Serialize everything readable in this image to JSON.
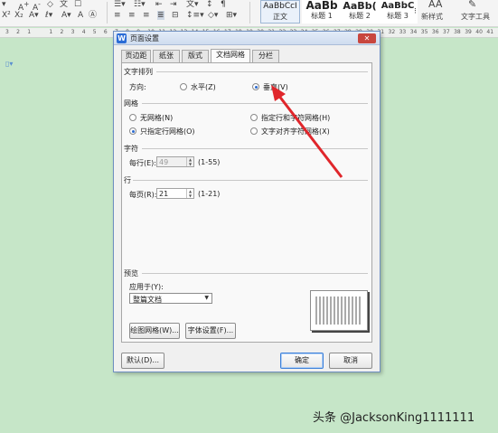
{
  "ribbon": {
    "styles": [
      {
        "sample": "AaBbCcI",
        "label": "正文"
      },
      {
        "sample": "AaBb",
        "label": "标题 1"
      },
      {
        "sample": "AaBb(",
        "label": "标题 2"
      },
      {
        "sample": "AaBbC",
        "label": "标题 3"
      }
    ],
    "new_style_label": "新样式",
    "text_tool_label": "文字工具"
  },
  "ruler": {
    "marks": [
      "3",
      "2",
      "1",
      "",
      "1",
      "2",
      "3",
      "4",
      "5",
      "6",
      "7",
      "8",
      "9",
      "10",
      "11",
      "12",
      "13",
      "14",
      "15",
      "16",
      "17",
      "18",
      "19",
      "20",
      "21",
      "22",
      "23",
      "24",
      "25",
      "26",
      "27",
      "28",
      "29",
      "30",
      "31",
      "32",
      "33",
      "34",
      "35",
      "36",
      "37",
      "38",
      "39",
      "40",
      "41"
    ]
  },
  "dialog": {
    "app_icon": "W",
    "title": "页面设置",
    "close_symbol": "✕",
    "tabs": [
      "页边距",
      "纸张",
      "版式",
      "文档网格",
      "分栏"
    ],
    "active_tab": "文档网格",
    "text_direction": {
      "group": "文字排列",
      "direction_label": "方向:",
      "horizontal": "水平(Z)",
      "vertical": "垂直(V)",
      "selected": "垂直(V)"
    },
    "grid": {
      "group": "网格",
      "options": [
        "无网格(N)",
        "指定行和字符网格(H)",
        "只指定行网格(O)",
        "文字对齐字符网格(X)"
      ],
      "selected": "只指定行网格(O)"
    },
    "characters": {
      "group": "字符",
      "per_line_label": "每行(E):",
      "per_line_value": "49",
      "range": "(1-55)"
    },
    "lines": {
      "group": "行",
      "per_page_label": "每页(R):",
      "per_page_value": "21",
      "range": "(1-21)"
    },
    "preview": {
      "group": "预览",
      "apply_label": "应用于(Y):",
      "apply_value": "整篇文档"
    },
    "buttons": {
      "drawing_grid": "绘图网格(W)...",
      "font_settings": "字体设置(F)...",
      "default": "默认(D)...",
      "ok": "确定",
      "cancel": "取消"
    }
  },
  "watermark": "头条 @JacksonKing1111111",
  "colors": {
    "background": "#c6e6c8",
    "accent": "#2c6bd0",
    "arrow": "#e0262b"
  }
}
